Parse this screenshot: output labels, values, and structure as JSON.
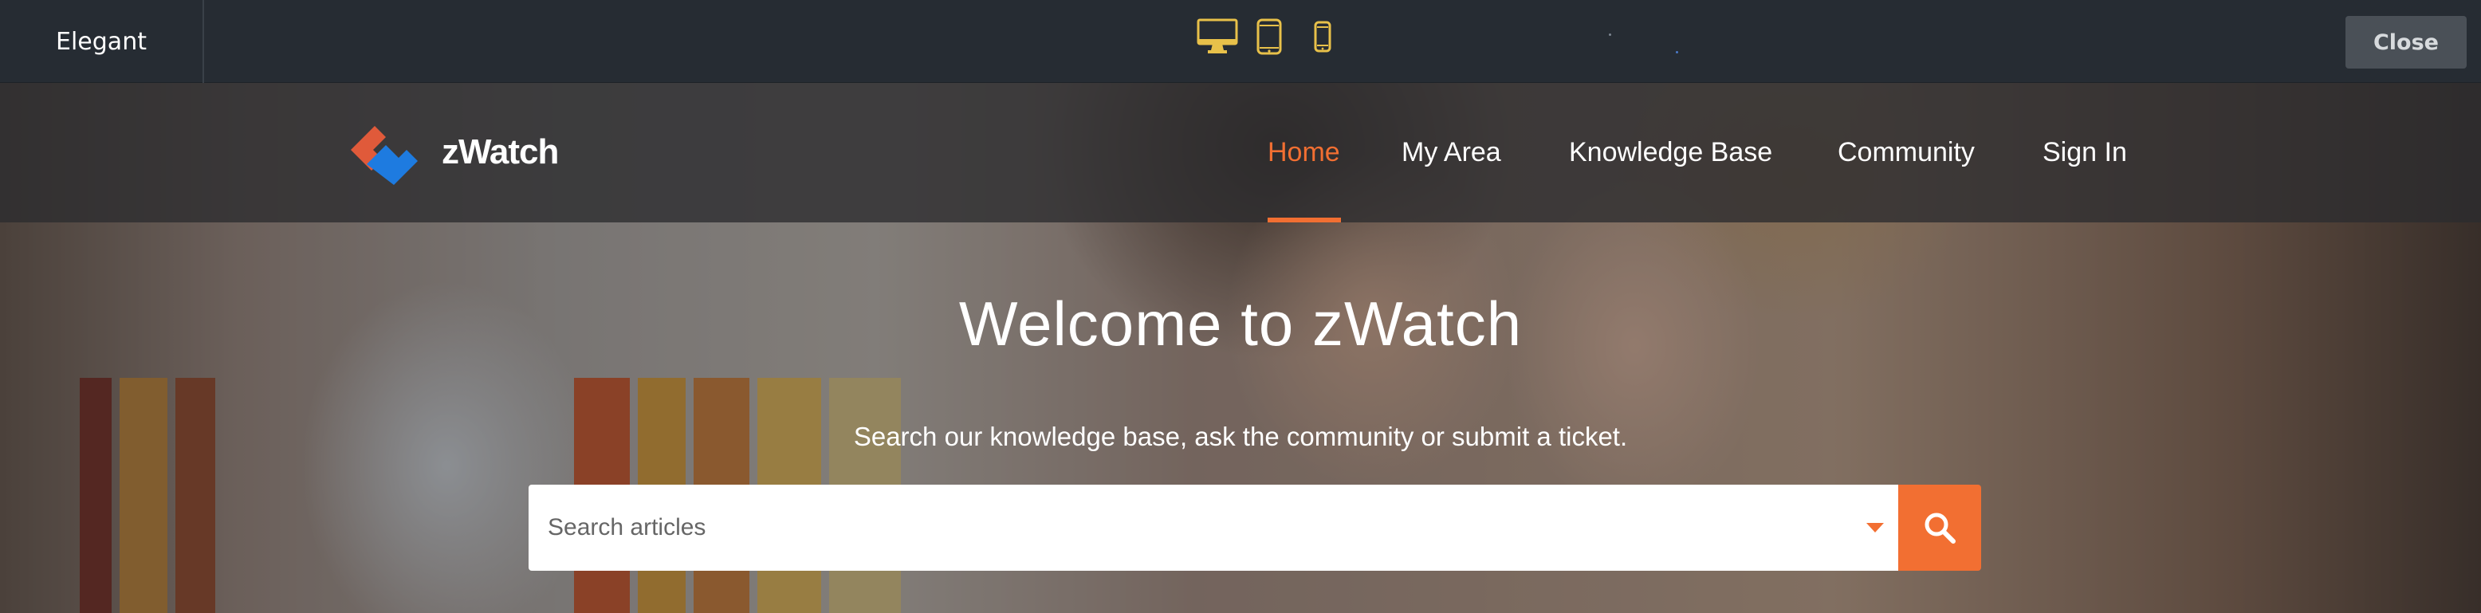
{
  "preview_bar": {
    "theme_name": "Elegant",
    "close_label": "Close",
    "devices": [
      {
        "name": "desktop-icon",
        "active": true
      },
      {
        "name": "tablet-icon",
        "active": false
      },
      {
        "name": "mobile-icon",
        "active": false
      }
    ],
    "device_icon_color": "#e8c14a"
  },
  "site": {
    "brand_name": "zWatch",
    "logo_colors": {
      "top": "#e05a3a",
      "bottom": "#1e7be0"
    },
    "nav": [
      {
        "label": "Home",
        "active": true
      },
      {
        "label": "My Area",
        "active": false
      },
      {
        "label": "Knowledge Base",
        "active": false
      },
      {
        "label": "Community",
        "active": false
      },
      {
        "label": "Sign In",
        "active": false
      }
    ],
    "accent_color": "#f26f32",
    "hero": {
      "title": "Welcome to zWatch",
      "subtitle": "Search our knowledge base, ask the community or submit a ticket.",
      "search_placeholder": "Search articles",
      "search_icon": "search-icon"
    }
  }
}
